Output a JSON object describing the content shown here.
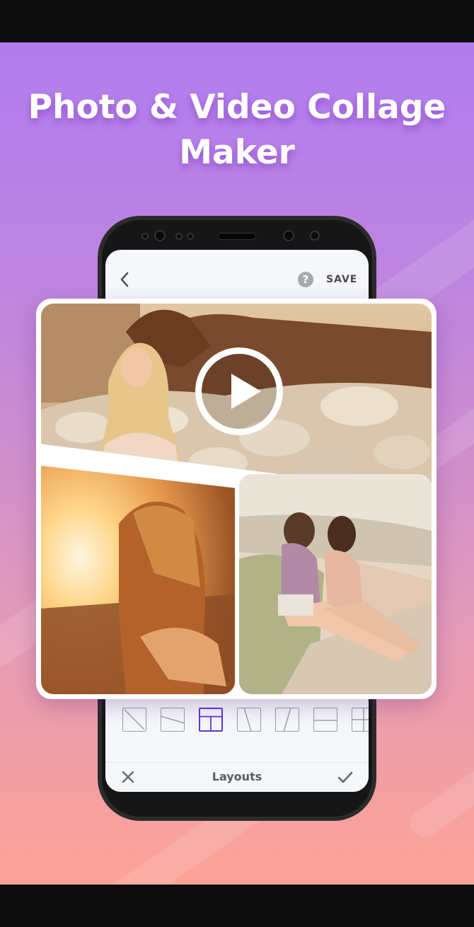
{
  "promo": {
    "headline_line1": "Photo & Video Collage",
    "headline_line2": "Maker"
  },
  "editor": {
    "save_label": "SAVE",
    "help_icon_glyph": "?",
    "bottom_bar_title": "Layouts",
    "selected_layout_index": 2,
    "layout_icons": [
      "diagonal-split-icon",
      "slanted-horizontal-split-icon",
      "three-panel-layout-icon",
      "slanted-vertical-split-icon",
      "diagonal-vertical-split-icon",
      "horizontal-split-icon",
      "grid-layout-icon"
    ]
  },
  "collage": {
    "photos": [
      "girl-with-horse-video",
      "sunset-holding-hands-photo",
      "two-friends-sitting-photo"
    ]
  },
  "colors": {
    "accent": "#5b39d6",
    "gradient_top": "#b27cf0",
    "gradient_bottom": "#fda396",
    "headline_text": "#ffffff"
  }
}
